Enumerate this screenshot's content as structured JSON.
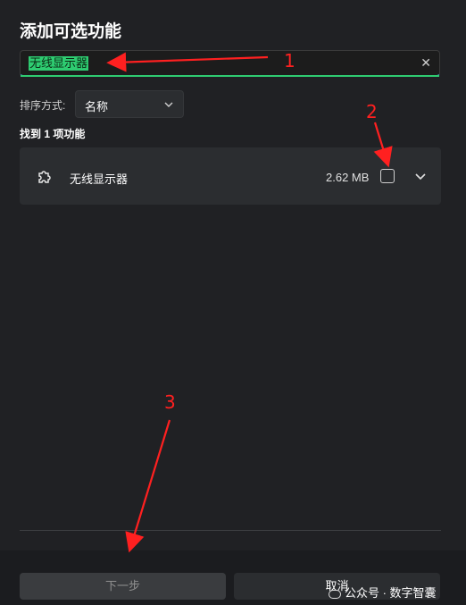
{
  "dialog": {
    "title": "添加可选功能"
  },
  "search": {
    "value": "无线显示器"
  },
  "sort": {
    "label": "排序方式:",
    "value": "名称"
  },
  "results": {
    "count_text": "找到 1 项功能",
    "items": [
      {
        "name": "无线显示器",
        "size": "2.62 MB",
        "checked": false
      }
    ]
  },
  "footer": {
    "next_label": "下一步",
    "cancel_label": "取消"
  },
  "watermark": {
    "text": "公众号 · 数字智囊"
  },
  "annotations": {
    "labels": [
      "1",
      "2",
      "3"
    ],
    "color": "#ff2020"
  },
  "colors": {
    "background": "#202124",
    "accent": "#2ecc71",
    "panel": "#2b2d30"
  }
}
